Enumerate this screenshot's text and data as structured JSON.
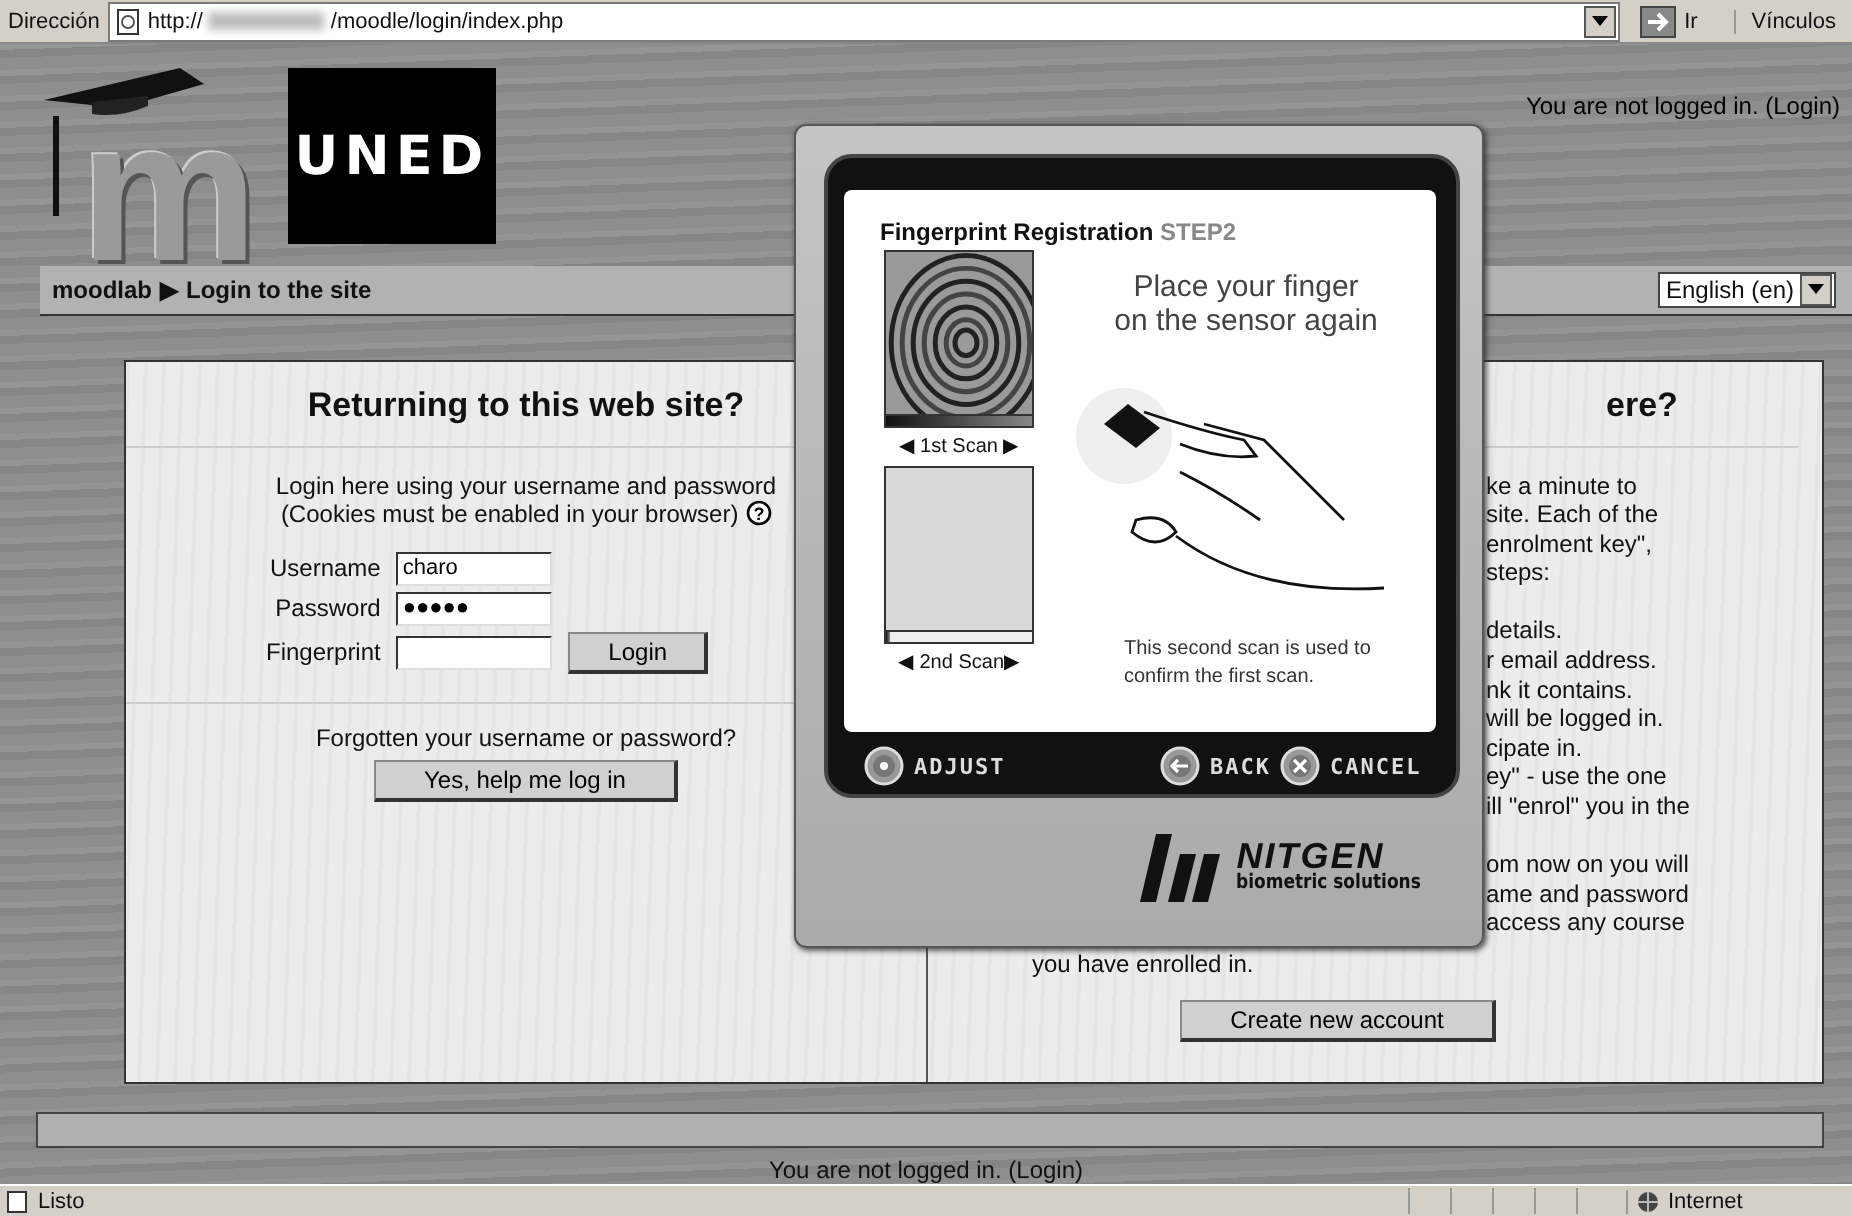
{
  "address_bar": {
    "label": "Dirección",
    "url_start": "http://",
    "url_end": "/moodle/login/index.php",
    "go": "Ir",
    "links": "Vínculos"
  },
  "header": {
    "logo_letter": "m",
    "logo_text": "UNED",
    "login_info": "You are not logged in.",
    "login_link": "(Login)"
  },
  "navbar": {
    "breadcrumbs": [
      "moodlab",
      "Login to the site"
    ],
    "separator": "▶",
    "language": "English (en)"
  },
  "login_panel": {
    "title": "Returning to this web site?",
    "intro": [
      "Login here using your username and password",
      "(Cookies must be enabled in your browser)"
    ],
    "help": "?",
    "fields": [
      {
        "label": "Username",
        "value": "charo"
      },
      {
        "label": "Password",
        "value": "●●●●●"
      },
      {
        "label": "Fingerprint"
      }
    ],
    "login_button": "Login",
    "forgot": "Forgotten your username or password?",
    "forgot_button": "Yes, help me log in"
  },
  "signup_panel": {
    "title": "ere?",
    "paragraphs": [
      [
        "ke a minute to",
        "site. Each of the",
        "enrolment key\",",
        "steps:"
      ],
      [
        "details.",
        "r email address.",
        "nk it contains.",
        "will be logged in.",
        "cipate in.",
        "ey\" - use the one",
        "ill \"enrol\" you in the"
      ],
      [
        "om now on you will",
        "ame and password",
        "access any course"
      ]
    ],
    "last_line": "you have enrolled in.",
    "button": "Create new account"
  },
  "footer": {
    "login_info": "You are not logged in.",
    "login_link": "(Login)"
  },
  "dialog": {
    "title": "Fingerprint Registration",
    "step": "STEP2",
    "scans": [
      {
        "label": "◀ 1st Scan ▶",
        "scanned": true,
        "level": 1
      },
      {
        "label": "◀ 2nd Scan▶",
        "scanned": false,
        "level": 0.03
      }
    ],
    "instruction": [
      "Place your finger",
      "on the sensor again"
    ],
    "note": [
      "This second scan is used to",
      "confirm the first scan."
    ],
    "buttons": [
      {
        "label": "ADJUST",
        "kind": "adjust"
      },
      {
        "label": "BACK",
        "kind": "back"
      },
      {
        "label": "CANCEL",
        "kind": "cancel"
      }
    ],
    "brand": "NITGEN",
    "tagline": "biometric solutions"
  },
  "status_bar": {
    "text": "Listo",
    "zone": "Internet"
  }
}
